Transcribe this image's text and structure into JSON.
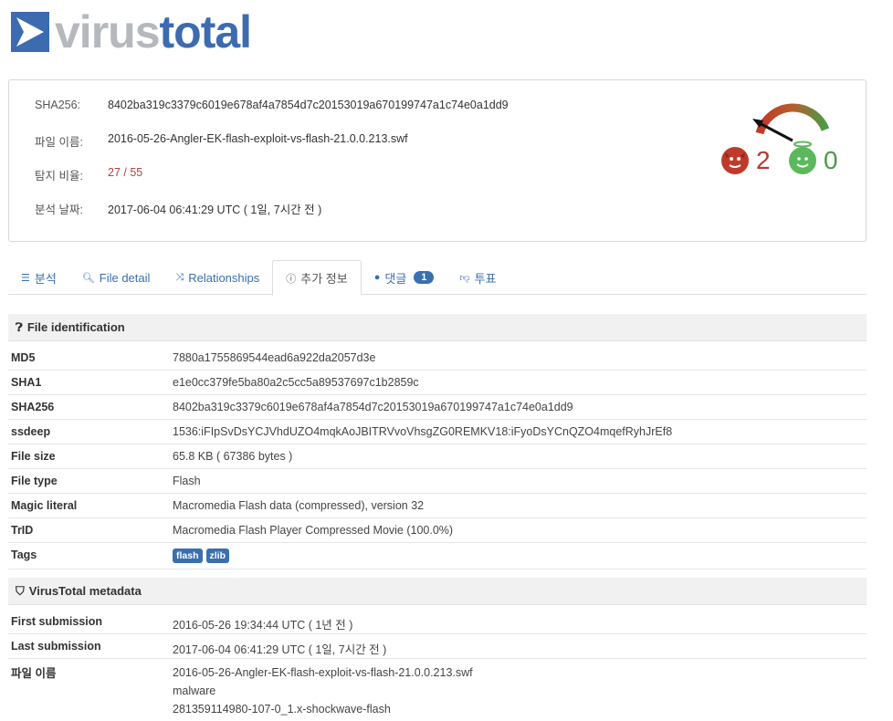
{
  "logo": {
    "virus": "virus",
    "total": "total"
  },
  "summary": {
    "rows": [
      {
        "label": "SHA256:",
        "value": "8402ba319c3379c6019e678af4a7854d7c20153019a670199747a1c74e0a1dd9"
      },
      {
        "label": "파일 이름:",
        "value": "2016-05-26-Angler-EK-flash-exploit-vs-flash-21.0.0.213.swf"
      },
      {
        "label": "탐지 비율:",
        "value": "27 / 55"
      },
      {
        "label": "분석 날짜:",
        "value": "2017-06-04 06:41:29 UTC ( 1일, 7시간 전 )"
      }
    ],
    "malicious_votes": "2",
    "harmless_votes": "0",
    "colors": {
      "bad": "#b23c2e",
      "good": "#4c9a47"
    }
  },
  "tabs": [
    {
      "label": "분석",
      "icon": "list-icon"
    },
    {
      "label": "File detail",
      "icon": "search-icon"
    },
    {
      "label": "Relationships",
      "icon": "shuffle-icon"
    },
    {
      "label": "추가 정보",
      "icon": "info-icon",
      "active": true
    },
    {
      "label": "댓글",
      "icon": "comment-icon",
      "badge": "1"
    },
    {
      "label": "투표",
      "icon": "thumbs-down-icon"
    }
  ],
  "file_identification": {
    "title": "File identification",
    "rows": [
      {
        "label": "MD5",
        "value": "7880a1755869544ead6a922da2057d3e"
      },
      {
        "label": "SHA1",
        "value": "e1e0cc379fe5ba80a2c5cc5a89537697c1b2859c"
      },
      {
        "label": "SHA256",
        "value": "8402ba319c3379c6019e678af4a7854d7c20153019a670199747a1c74e0a1dd9"
      },
      {
        "label": "ssdeep",
        "value": "1536:iFIpSvDsYCJVhdUZO4mqkAoJBITRVvoVhsgZG0REMKV18:iFyoDsYCnQZO4mqefRyhJrEf8"
      },
      {
        "label": "File size",
        "value": "65.8 KB ( 67386 bytes )"
      },
      {
        "label": "File type",
        "value": "Flash"
      },
      {
        "label": "Magic literal",
        "value": "Macromedia Flash data (compressed), version 32"
      },
      {
        "label": "TrID",
        "value": "Macromedia Flash Player Compressed Movie (100.0%)"
      }
    ],
    "tags_label": "Tags",
    "tags": [
      "flash",
      "zlib"
    ]
  },
  "metadata": {
    "title": "VirusTotal metadata",
    "first_label": "First submission",
    "first_value": "2016-05-26 19:34:44 UTC ( 1년 전 )",
    "last_label": "Last submission",
    "last_value": "2017-06-04 06:41:29 UTC ( 1일, 7시간 전 )",
    "names_label": "파일 이름",
    "names": [
      "2016-05-26-Angler-EK-flash-exploit-vs-flash-21.0.0.213.swf",
      "malware",
      "281359114980-107-0_1.x-shockwave-flash"
    ]
  }
}
